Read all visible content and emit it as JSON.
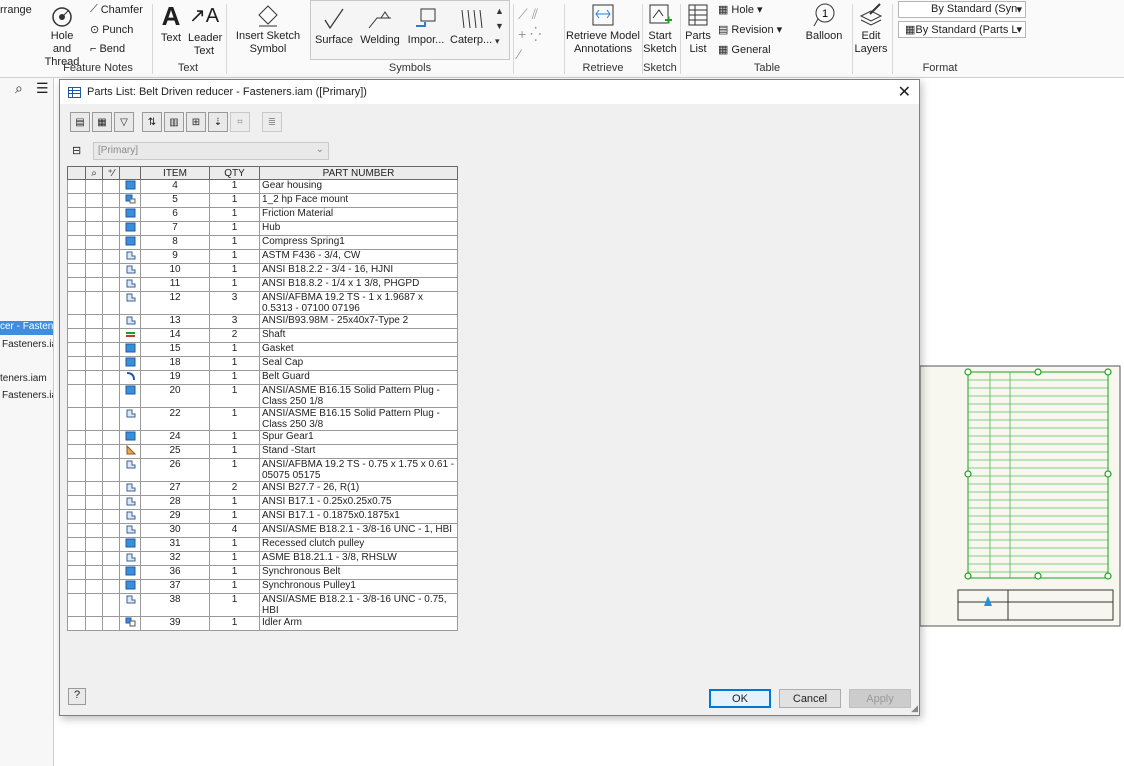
{
  "ribbon": {
    "arrange_label": "rrange",
    "feature_notes": {
      "hole_thread": "Hole and Thread",
      "chamfer": "Chamfer",
      "punch": "Punch",
      "bend": "Bend",
      "group": "Feature Notes"
    },
    "text_group": {
      "text": "Text",
      "leader_text": "Leader Text",
      "group": "Text"
    },
    "symbols": {
      "insert_sketch_symbol": "Insert Sketch Symbol",
      "surface": "Surface",
      "welding": "Welding",
      "import": "Impor...",
      "caterpillar": "Caterp...",
      "group": "Symbols"
    },
    "retrieve": {
      "retrieve_model_annotations": "Retrieve Model Annotations",
      "group": "Retrieve"
    },
    "sketch": {
      "start_sketch": "Start Sketch",
      "group": "Sketch"
    },
    "table": {
      "parts_list": "Parts List",
      "hole": "Hole",
      "revision": "Revision",
      "general": "General",
      "balloon": "Balloon",
      "group": "Table"
    },
    "edit_layers": "Edit Layers",
    "format": {
      "style_select_1": "By Standard (Syn",
      "style_select_2": "By Standard (Parts L",
      "group": "Format"
    }
  },
  "browser": {
    "items": [
      "cer - Fastene",
      "Fasteners.ia",
      "teners.iam",
      "Fasteners.ia"
    ]
  },
  "dialog": {
    "title": "Parts List: Belt Driven reducer - Fasteners.iam ([Primary])",
    "bom_view": "[Primary]",
    "columns": [
      "ITEM",
      "QTY",
      "PART NUMBER"
    ],
    "rows": [
      {
        "icon": "part",
        "item": "4",
        "qty": "1",
        "part": "Gear housing"
      },
      {
        "icon": "part-sub",
        "item": "5",
        "qty": "1",
        "part": "1_2 hp Face mount"
      },
      {
        "icon": "part",
        "item": "6",
        "qty": "1",
        "part": "Friction Material"
      },
      {
        "icon": "part",
        "item": "7",
        "qty": "1",
        "part": "Hub"
      },
      {
        "icon": "part",
        "item": "8",
        "qty": "1",
        "part": "Compress Spring1"
      },
      {
        "icon": "fastener",
        "item": "9",
        "qty": "1",
        "part": "ASTM F436 - 3/4, CW"
      },
      {
        "icon": "fastener",
        "item": "10",
        "qty": "1",
        "part": "ANSI B18.2.2 - 3/4 - 16, HJNI"
      },
      {
        "icon": "fastener",
        "item": "11",
        "qty": "1",
        "part": "ANSI B18.8.2 - 1/4 x 1 3/8, PHGPD"
      },
      {
        "icon": "fastener",
        "item": "12",
        "qty": "3",
        "part": "ANSI/AFBMA 19.2 TS - 1 x 1.9687 x 0.5313 - 07100 07196"
      },
      {
        "icon": "fastener",
        "item": "13",
        "qty": "3",
        "part": "ANSI/B93.98M - 25x40x7-Type 2"
      },
      {
        "icon": "shaft",
        "item": "14",
        "qty": "2",
        "part": "Shaft"
      },
      {
        "icon": "part",
        "item": "15",
        "qty": "1",
        "part": "Gasket"
      },
      {
        "icon": "part",
        "item": "18",
        "qty": "1",
        "part": "Seal Cap"
      },
      {
        "icon": "guard",
        "item": "19",
        "qty": "1",
        "part": "Belt Guard"
      },
      {
        "icon": "part",
        "item": "20",
        "qty": "1",
        "part": "ANSI/ASME B16.15 Solid Pattern Plug - Class 250 1/8"
      },
      {
        "icon": "fastener",
        "item": "22",
        "qty": "1",
        "part": "ANSI/ASME B16.15 Solid Pattern Plug - Class 250 3/8"
      },
      {
        "icon": "part",
        "item": "24",
        "qty": "1",
        "part": "Spur Gear1"
      },
      {
        "icon": "stand",
        "item": "25",
        "qty": "1",
        "part": "Stand -Start"
      },
      {
        "icon": "fastener",
        "item": "26",
        "qty": "1",
        "part": "ANSI/AFBMA 19.2 TS - 0.75 x 1.75 x 0.61 - 05075 05175"
      },
      {
        "icon": "fastener",
        "item": "27",
        "qty": "2",
        "part": "ANSI B27.7 - 26, R(1)"
      },
      {
        "icon": "fastener",
        "item": "28",
        "qty": "1",
        "part": "ANSI B17.1 - 0.25x0.25x0.75"
      },
      {
        "icon": "fastener",
        "item": "29",
        "qty": "1",
        "part": "ANSI B17.1 - 0.1875x0.1875x1"
      },
      {
        "icon": "fastener",
        "item": "30",
        "qty": "4",
        "part": "ANSI/ASME B18.2.1 - 3/8-16 UNC - 1, HBI"
      },
      {
        "icon": "part",
        "item": "31",
        "qty": "1",
        "part": "Recessed clutch pulley"
      },
      {
        "icon": "fastener",
        "item": "32",
        "qty": "1",
        "part": "ASME B18.21.1 - 3/8, RHSLW"
      },
      {
        "icon": "part",
        "item": "36",
        "qty": "1",
        "part": "Synchronous Belt"
      },
      {
        "icon": "part",
        "item": "37",
        "qty": "1",
        "part": "Synchronous Pulley1"
      },
      {
        "icon": "fastener",
        "item": "38",
        "qty": "1",
        "part": "ANSI/ASME B18.2.1 - 3/8-16 UNC - 0.75, HBI"
      },
      {
        "icon": "assembly",
        "item": "39",
        "qty": "1",
        "part": "Idler Arm"
      }
    ],
    "ok": "OK",
    "cancel": "Cancel",
    "apply": "Apply"
  },
  "colors": {
    "part_blue": "#3a8fd9",
    "balloon_green": "#1aa31a",
    "ok_border": "#0078d7"
  }
}
